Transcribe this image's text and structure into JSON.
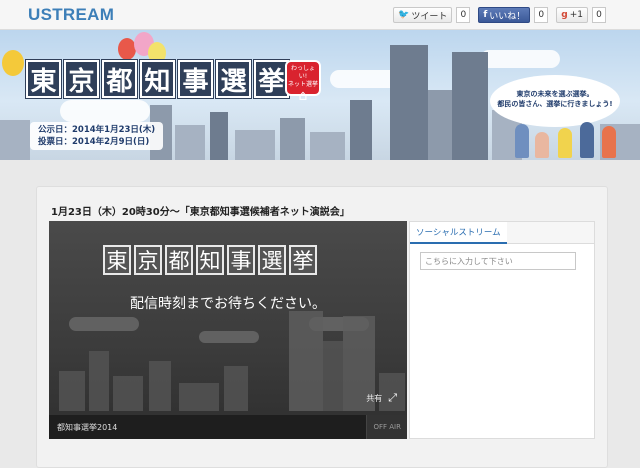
{
  "brand": {
    "logo": "USTREAM"
  },
  "social": {
    "tweet_label": "ツイート",
    "tweet_count": "0",
    "like_label": "いいね！",
    "like_count": "0",
    "gplus_label": "+1",
    "gplus_count": "0"
  },
  "banner": {
    "title_chars": [
      "東",
      "京",
      "都",
      "知",
      "事",
      "選",
      "挙"
    ],
    "badge_line1": "わっしょい!",
    "badge_line2": "ネット選挙",
    "date_announce": "公示日：2014年1月23日(木)",
    "date_vote": "投票日：2014年2月9日(日)",
    "bubble_line1": "東京の未来を選ぶ選挙。",
    "bubble_line2": "都民の皆さん、選挙に行きましょう!"
  },
  "main": {
    "headline": "1月23日（木）20時30分〜「東京都知事選候補者ネット演説会」",
    "player": {
      "title_chars": [
        "東",
        "京",
        "都",
        "知",
        "事",
        "選",
        "挙"
      ],
      "message": "配信時刻までお待ちください。",
      "share_label": "共有",
      "channel_name": "都知事選挙2014",
      "status": "OFF AIR"
    },
    "stream": {
      "tab_label": "ソーシャルストリーム",
      "input_placeholder": "こちらに入力して下さい"
    }
  },
  "colors": {
    "accent": "#3d7fb8",
    "title_bg": "#2f3f59",
    "badge_red": "#d9232e",
    "facebook": "#3b5998"
  }
}
